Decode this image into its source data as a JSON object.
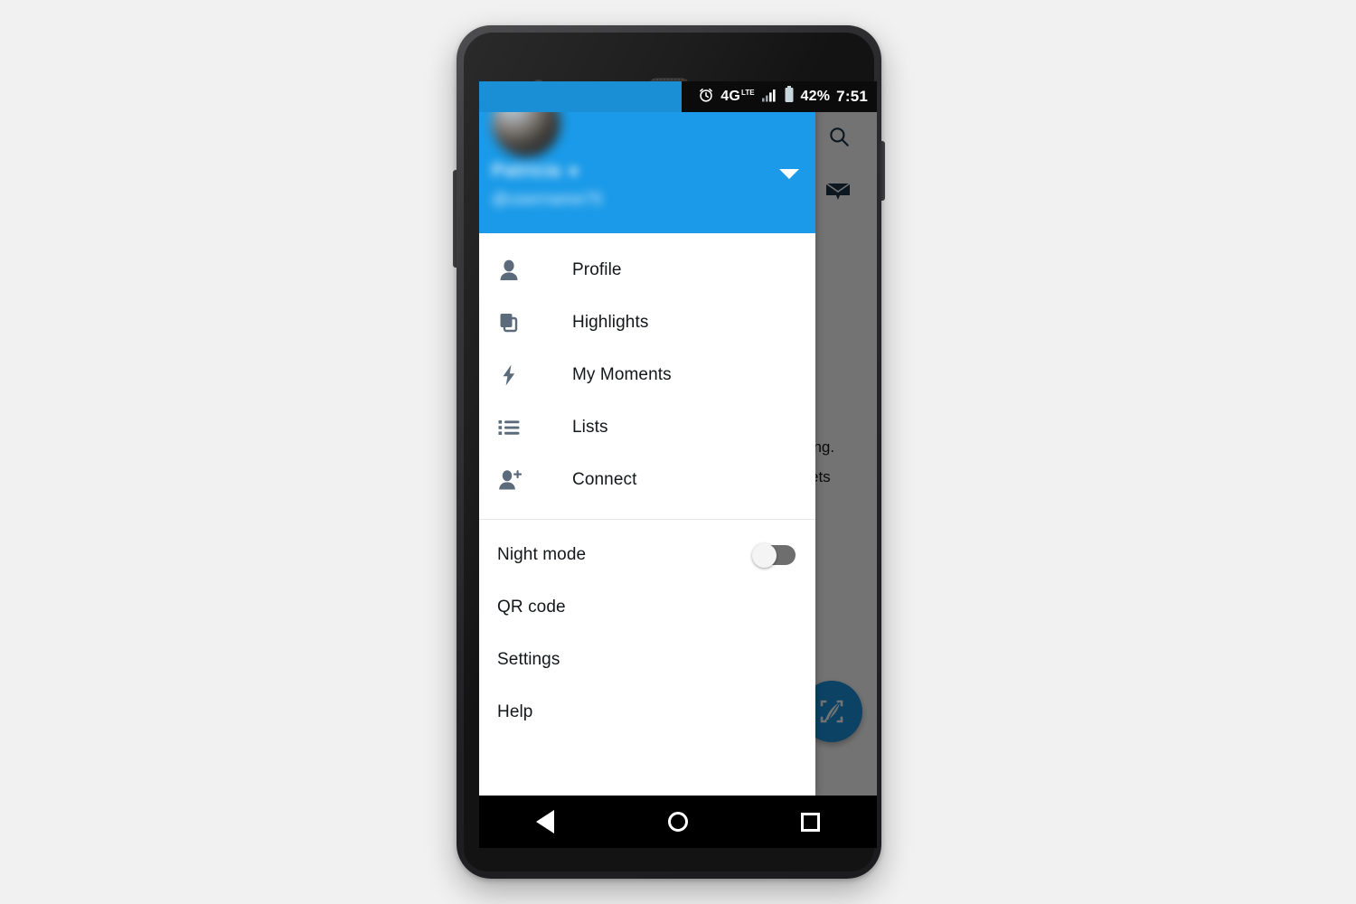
{
  "device": {
    "name": "android-phone",
    "camera": "front-camera",
    "speaker": "earpiece-speaker",
    "buttons": {
      "volume": "volume-rocker",
      "power": "power-button"
    }
  },
  "status_bar": {
    "alarm_icon": "alarm-clock-icon",
    "network_label": "4G",
    "network_sub_label": "LTE",
    "signal_icon": "signal-bars-icon",
    "battery_icon": "battery-icon",
    "battery_percent": "42%",
    "clock": "7:51",
    "background": "#0b0b0b",
    "accent": "#1a8fd6"
  },
  "drawer": {
    "header": {
      "avatar": "user-avatar-blurred",
      "account_name": "Patricia",
      "lock_glyph": "●",
      "account_handle": "@username75",
      "chevron_icon": "chevron-down-icon",
      "background": "#1a9ae8",
      "blurred": true
    },
    "primary_items": [
      {
        "label": "Profile",
        "icon": "person-icon"
      },
      {
        "label": "Highlights",
        "icon": "stacked-cards-icon"
      },
      {
        "label": "My Moments",
        "icon": "lightning-bolt-icon"
      },
      {
        "label": "Lists",
        "icon": "list-icon"
      },
      {
        "label": "Connect",
        "icon": "person-add-icon"
      }
    ],
    "secondary_items": [
      {
        "label": "Night mode",
        "control": "toggle-switch",
        "state": "off"
      },
      {
        "label": "QR code",
        "control": "none"
      },
      {
        "label": "Settings",
        "control": "none"
      },
      {
        "label": "Help",
        "control": "none"
      }
    ],
    "icon_color": "#5b6b7b"
  },
  "app_behind": {
    "search_icon": "search-icon",
    "messages_icon": "message-envelope-icon",
    "visible_text_line_1": "ong.",
    "visible_text_line_2": "ets",
    "compose_fab": {
      "icon": "compose-quill-icon",
      "color": "#1b95e0"
    },
    "scrim_color": "rgba(0,0,0,0.55)"
  },
  "nav_bar": {
    "back": "back-triangle-icon",
    "home": "home-circle-icon",
    "recents": "recents-square-icon",
    "background": "#000000"
  },
  "background_color": "#f1f1f1"
}
